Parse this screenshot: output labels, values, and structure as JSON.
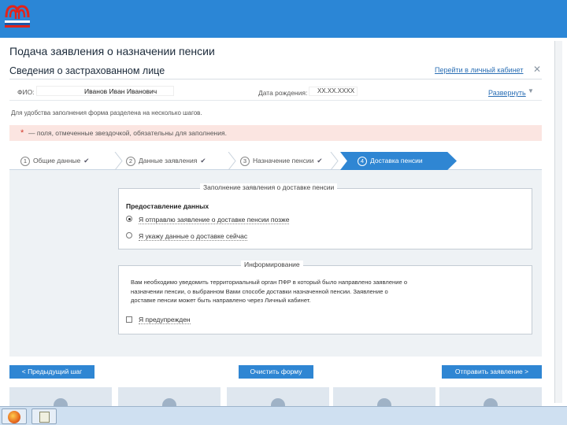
{
  "header": {
    "logo": "pfr-logo"
  },
  "page": {
    "title": "Подача заявления о назначении пенсии"
  },
  "section": {
    "title": "Сведения о застрахованном лице",
    "cabinet_link": "Перейти в личный кабинет"
  },
  "person": {
    "fio_label": "ФИО:",
    "fio_value": "Иванов Иван Иванович",
    "dob_label": "Дата рождения:",
    "dob_value": "ХХ.ХХ.ХХХХ",
    "expand_link": "Развернуть"
  },
  "info_text": "Для удобства заполнения форма разделена на несколько шагов.",
  "required_note": {
    "star": "*",
    "text": "— поля, отмеченные звездочкой, обязательны для заполнения."
  },
  "steps": [
    {
      "num": "1",
      "label": "Общие данные",
      "done": true
    },
    {
      "num": "2",
      "label": "Данные заявления",
      "done": true
    },
    {
      "num": "3",
      "label": "Назначение пенсии",
      "done": true
    },
    {
      "num": "4",
      "label": "Доставка пенсии",
      "active": true
    }
  ],
  "fieldset_delivery": {
    "legend": "Заполнение заявления о доставке пенсии",
    "subhead": "Предоставление данных",
    "options": [
      {
        "label": "Я отправлю заявление о доставке пенсии позже",
        "checked": true
      },
      {
        "label": "Я укажу данные о доставке сейчас",
        "checked": false
      }
    ]
  },
  "fieldset_info": {
    "legend": "Информирование",
    "notice": "Вам необходимо уведомить территориальный орган ПФР в который было направлено заявление о назначении пенсии, о выбранном Вами способе доставки назначенной пенсии. Заявление о доставке пенсии может быть направлено через Личный кабинет.",
    "checkbox_label": "Я предупрежден"
  },
  "buttons": {
    "prev": "< Предыдущий шаг",
    "clear": "Очистить форму",
    "send": "Отправить заявление >"
  },
  "taskbar": {
    "items": [
      "firefox-icon",
      "app-icon"
    ]
  },
  "colors": {
    "accent": "#2f86d3",
    "topbar": "#2b86d6",
    "required_bg": "#fbe5e1",
    "panel_bg": "#eef2f5"
  }
}
